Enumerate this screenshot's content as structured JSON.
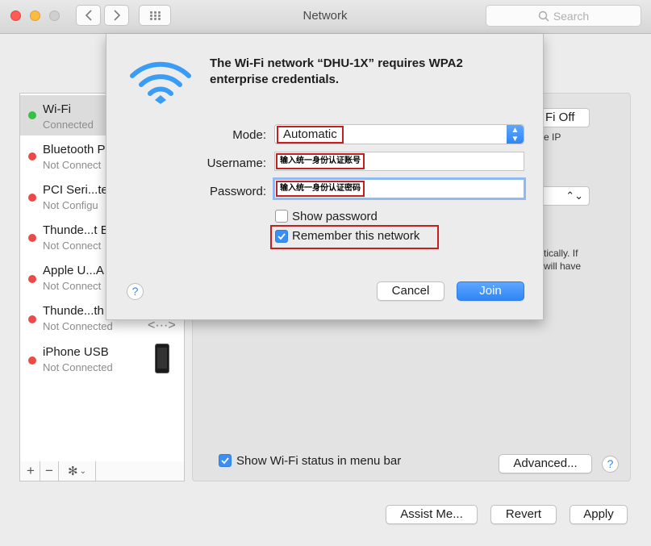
{
  "window": {
    "title": "Network",
    "search_placeholder": "Search"
  },
  "sidebar": {
    "items": [
      {
        "name": "Wi-Fi",
        "status": "Connected",
        "dot": "green"
      },
      {
        "name": "Bluetooth P",
        "status": "Not Connect",
        "dot": "red"
      },
      {
        "name": "PCI Seri...te",
        "status": "Not Configu",
        "dot": "red"
      },
      {
        "name": "Thunde...t B",
        "status": "Not Connect",
        "dot": "red"
      },
      {
        "name": "Apple U...A",
        "status": "Not Connect",
        "dot": "red"
      },
      {
        "name": "Thunde...th",
        "status": "Not Connected",
        "dot": "red"
      },
      {
        "name": "iPhone USB",
        "status": "Not Connected",
        "dot": "red"
      }
    ],
    "tools": {
      "add": "+",
      "remove": "−",
      "gear": "✻"
    }
  },
  "panel": {
    "wifi_off_fragment": "Fi Off",
    "ip_fragment": "e IP",
    "auto_fragment_1": "tically. If",
    "auto_fragment_2": "will have",
    "show_status_label": "Show Wi-Fi status in menu bar",
    "show_status_checked": true,
    "advanced_label": "Advanced...",
    "help_label": "?"
  },
  "footer": {
    "assist_label": "Assist Me...",
    "revert_label": "Revert",
    "apply_label": "Apply"
  },
  "dialog": {
    "title": "The Wi-Fi network “DHU-1X” requires WPA2 enterprise credentials.",
    "mode_label": "Mode:",
    "mode_value": "Automatic",
    "username_label": "Username:",
    "username_value": "输入统一身份认证账号",
    "password_label": "Password:",
    "password_value": "输入统一身份认证密码",
    "show_password_label": "Show password",
    "show_password_checked": false,
    "remember_label": "Remember this network",
    "remember_checked": true,
    "help_label": "?",
    "cancel_label": "Cancel",
    "join_label": "Join"
  },
  "colors": {
    "accent": "#2f86f5",
    "highlight_box": "#c81e1e",
    "connected": "#35c144",
    "disconnected": "#ec4a46"
  }
}
